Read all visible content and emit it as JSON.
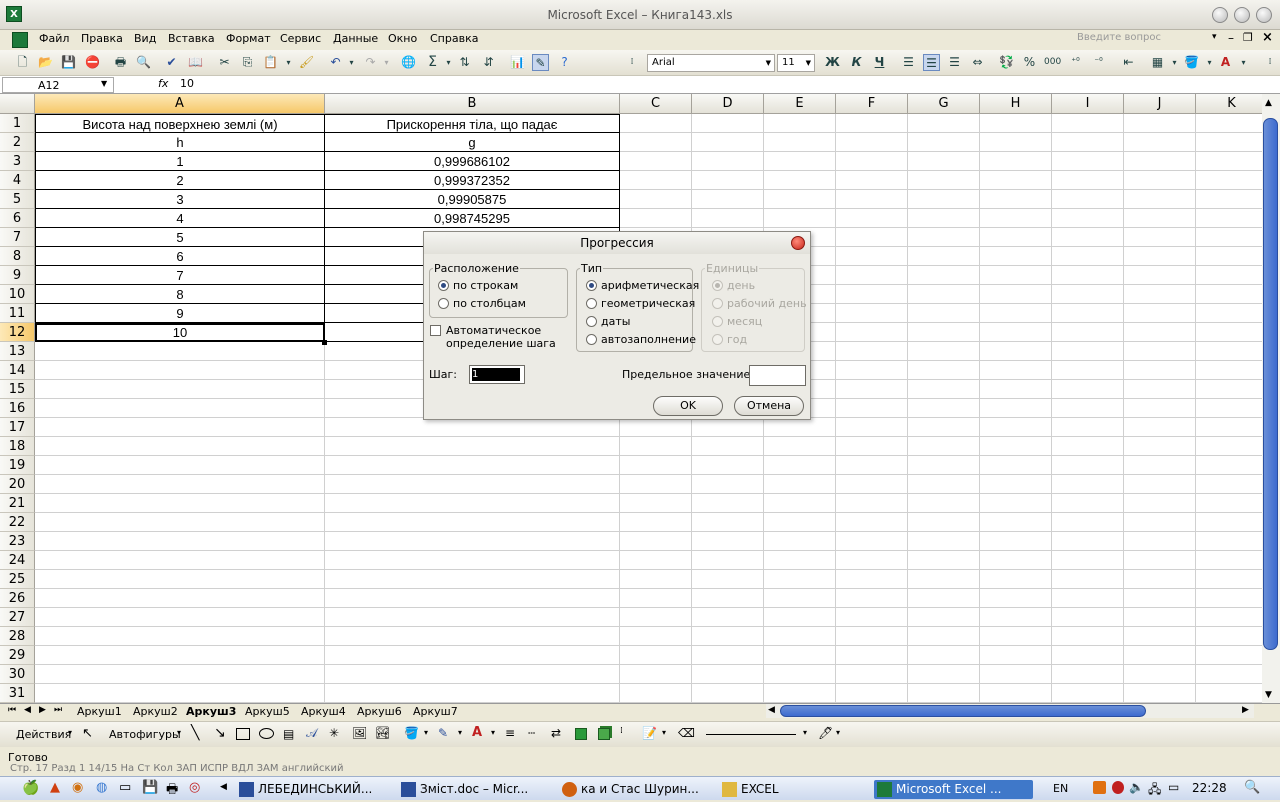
{
  "window": {
    "title": "Microsoft Excel – Книга143.xls",
    "app_icon": "X"
  },
  "menu": {
    "items": [
      "Файл",
      "Правка",
      "Вид",
      "Вставка",
      "Формат",
      "Сервис",
      "Данные",
      "Окно",
      "Справка"
    ],
    "help_placeholder": "Введите вопрос"
  },
  "toolbar": {
    "font": "Arial",
    "size": "11",
    "bold": "Ж",
    "italic": "К",
    "underline": "Ч",
    "sum": "Σ",
    "percent": "%",
    "thousands": "000"
  },
  "formula_bar": {
    "cell_ref": "A12",
    "fx": "fx",
    "value": "10"
  },
  "columns": [
    "A",
    "B",
    "C",
    "D",
    "E",
    "F",
    "G",
    "H",
    "I",
    "J",
    "K"
  ],
  "rows": [
    "1",
    "2",
    "3",
    "4",
    "5",
    "6",
    "7",
    "8",
    "9",
    "10",
    "11",
    "12",
    "13",
    "14",
    "15",
    "16",
    "17",
    "18",
    "19",
    "20",
    "21",
    "22",
    "23",
    "24",
    "25",
    "26",
    "27",
    "28",
    "29",
    "30",
    "31"
  ],
  "cells": {
    "header_a": "Висота над поверхнею землі (м)",
    "header_b": "Прискорення тіла, що падає",
    "sym_a": "h",
    "sym_b": "g",
    "col_a": [
      "1",
      "2",
      "3",
      "4",
      "5",
      "6",
      "7",
      "8",
      "9",
      "10"
    ],
    "col_b": [
      "0,999686102",
      "0,999372352",
      "0,99905875",
      "0,998745295"
    ]
  },
  "sheets": [
    "Аркуш1",
    "Аркуш2",
    "Аркуш3",
    "Аркуш5",
    "Аркуш4",
    "Аркуш6",
    "Аркуш7"
  ],
  "active_sheet": "Аркуш3",
  "drawing": {
    "actions": "Действия",
    "autoshapes": "Автофигуры"
  },
  "status": {
    "text": "Готово",
    "hidden": "Стр. 17     Разд 1     14/15     На     Ст     Кол     ЗАП  ИСПР  ВДЛ  ЗАМ  английский"
  },
  "dialog": {
    "title": "Прогрессия",
    "layout_label": "Расположение",
    "layout_options": [
      "по строкам",
      "по столбцам"
    ],
    "type_label": "Тип",
    "type_options": [
      "арифметическая",
      "геометрическая",
      "даты",
      "автозаполнение"
    ],
    "units_label": "Единицы",
    "units_options": [
      "день",
      "рабочий день",
      "месяц",
      "год"
    ],
    "auto_step": "Автоматическое определение шага",
    "step_label": "Шаг:",
    "step_value": "1",
    "limit_label": "Предельное значение:",
    "limit_value": "",
    "ok": "OK",
    "cancel": "Отмена"
  },
  "taskbar": {
    "items": [
      "ЛЕБЕДИНСЬКИЙ...",
      "Зміст.doc – Micr...",
      "ка и Стас Шурин...",
      "EXCEL",
      "Microsoft Excel ..."
    ],
    "lang": "EN",
    "clock": "22:28"
  }
}
